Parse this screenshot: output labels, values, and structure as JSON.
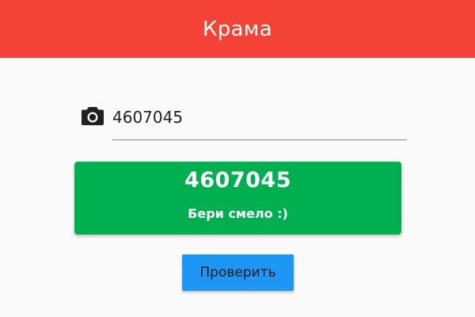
{
  "app_bar": {
    "title": "Крама",
    "color": "#f44336"
  },
  "barcode_field": {
    "icon": "camera-icon",
    "value": "4607045"
  },
  "result_card": {
    "code": "4607045",
    "message": "Бери смело :)",
    "color": "#00b050"
  },
  "check_button": {
    "label": "Проверить",
    "color": "#1e96f3"
  }
}
